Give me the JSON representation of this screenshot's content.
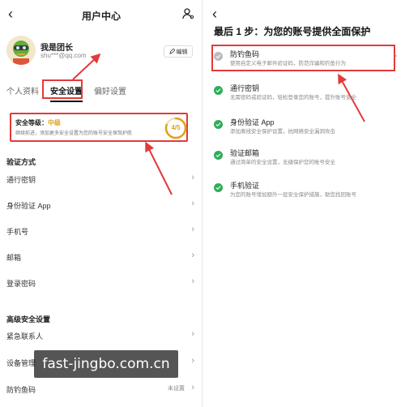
{
  "left": {
    "title": "用户中心",
    "user": {
      "name": "我是团长",
      "email": "shu***@qq.com"
    },
    "edit_label": "编辑",
    "tabs": [
      {
        "label": "个人资料",
        "active": false
      },
      {
        "label": "安全设置",
        "active": true
      },
      {
        "label": "偏好设置",
        "active": false
      }
    ],
    "security": {
      "label": "安全等级：",
      "level": "中级",
      "desc": "继续前进，添加更多安全设置为您的账号安全保驾护航",
      "score": "4/5",
      "progress": 0.8
    },
    "verify_header": "验证方式",
    "verify_items": [
      "通行密钥",
      "身份验证 App",
      "手机号",
      "邮箱",
      "登录密码"
    ],
    "advanced_header": "高级安全设置",
    "advanced_items": [
      {
        "label": "紧急联系人",
        "value": ""
      },
      {
        "label": "设备管理",
        "value": ""
      },
      {
        "label": "防钓鱼码",
        "value": "未设置"
      }
    ],
    "watermark": "fast-jingbo.com.cn"
  },
  "right": {
    "title": "最后 1 步：为您的账号提供全面保护",
    "items": [
      {
        "title": "防钓鱼码",
        "desc": "使用自定义电子邮件验证码，防范诈骗和钓鱼行为",
        "done": false
      },
      {
        "title": "通行密钥",
        "desc": "无需密码或验证码，轻松登录您的账号，提升账号安全",
        "done": true
      },
      {
        "title": "身份验证 App",
        "desc": "添加离线安全保护设置，抗网络安全漏洞攻击",
        "done": true
      },
      {
        "title": "验证邮箱",
        "desc": "通过简单的安全设置，无缝保护您的账号安全",
        "done": true
      },
      {
        "title": "手机验证",
        "desc": "为您的账号增加额外一层安全保护措施，助您找回账号",
        "done": true
      }
    ]
  },
  "colors": {
    "danger": "#e23b3b",
    "warn": "#e0a21c",
    "success": "#2fae5b"
  }
}
